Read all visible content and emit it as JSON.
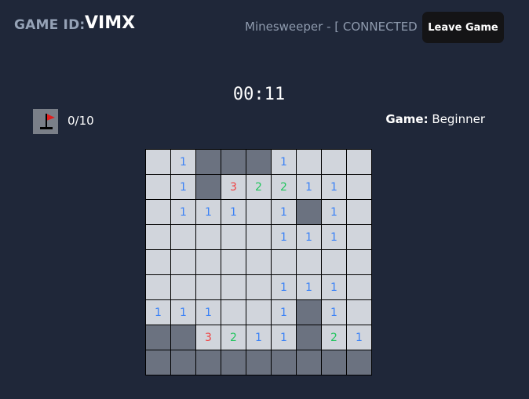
{
  "header": {
    "game_id_label": "GAME ID:",
    "game_id": "VIMX",
    "status": "Minesweeper - [ CONNECTED ]",
    "leave_label": "Leave Game"
  },
  "timer": "00:11",
  "flags": {
    "icon": "flag-icon",
    "count": "0/10"
  },
  "difficulty": {
    "label": "Game:",
    "value": "Beginner"
  },
  "colors": {
    "background": "#1f2739",
    "revealed": "#d1d5dc",
    "hidden": "#6b7280",
    "n1": "#3b82f6",
    "n2": "#22c55e",
    "n3": "#ef4444",
    "flag": "#e11d1d"
  },
  "board": {
    "rows": 9,
    "cols": 9,
    "cells": [
      [
        " ",
        "1",
        "#",
        "#",
        "#",
        "1",
        " ",
        " ",
        " "
      ],
      [
        " ",
        "1",
        "#",
        "3",
        "2",
        "2",
        "1",
        "1",
        " "
      ],
      [
        " ",
        "1",
        "1",
        "1",
        " ",
        "1",
        "#",
        "1",
        " "
      ],
      [
        " ",
        " ",
        " ",
        " ",
        " ",
        "1",
        "1",
        "1",
        " "
      ],
      [
        " ",
        " ",
        " ",
        " ",
        " ",
        " ",
        " ",
        " ",
        " "
      ],
      [
        " ",
        " ",
        " ",
        " ",
        " ",
        "1",
        "1",
        "1",
        " "
      ],
      [
        "1",
        "1",
        "1",
        " ",
        " ",
        "1",
        "#",
        "1",
        " "
      ],
      [
        "#",
        "#",
        "3",
        "2",
        "1",
        "1",
        "#",
        "2",
        "1"
      ],
      [
        "#",
        "#",
        "#",
        "#",
        "#",
        "#",
        "#",
        "#",
        "#"
      ]
    ]
  }
}
